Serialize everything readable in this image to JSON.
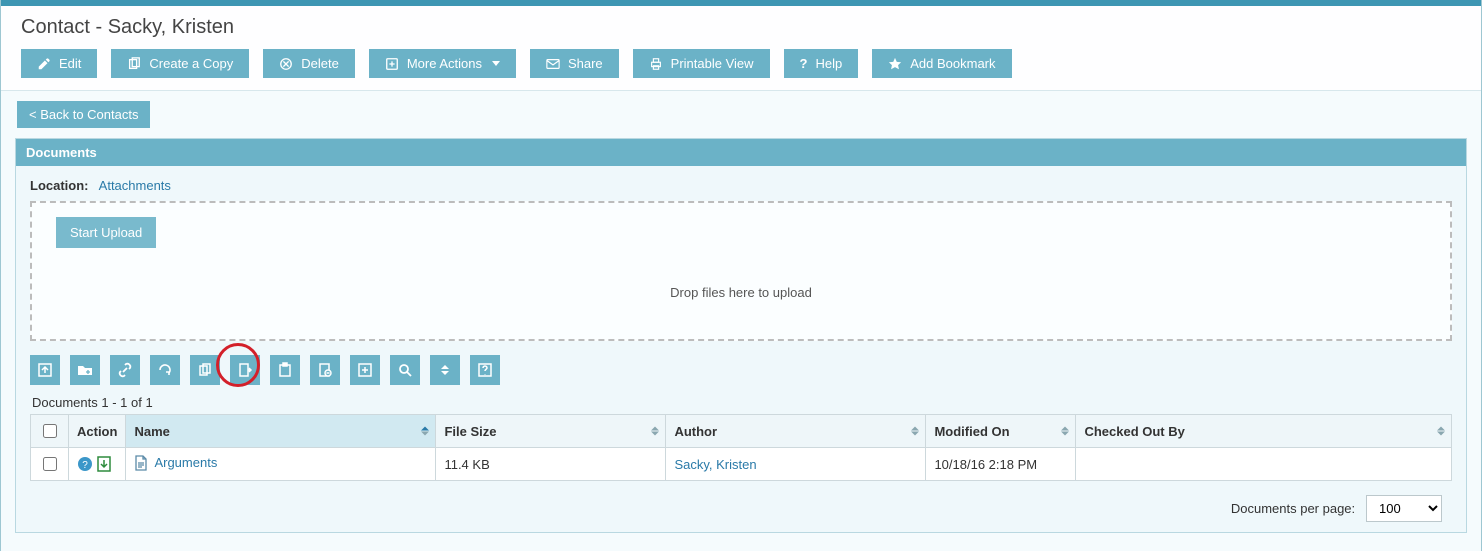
{
  "header": {
    "title": "Contact - Sacky, Kristen",
    "buttons": {
      "edit": "Edit",
      "copy": "Create a Copy",
      "delete": "Delete",
      "more": "More Actions",
      "share": "Share",
      "print": "Printable View",
      "help": "Help",
      "bookmark": "Add Bookmark"
    }
  },
  "back_button": "< Back to Contacts",
  "panel": {
    "title": "Documents",
    "location_label": "Location:",
    "location_value": "Attachments",
    "upload_button": "Start Upload",
    "drop_text": "Drop files here to upload"
  },
  "toolbar_icons": [
    "upload-icon",
    "new-folder-icon",
    "link-icon",
    "refresh-icon",
    "copy-icon",
    "export-icon",
    "paste-icon",
    "cancel-doc-icon",
    "move-icon",
    "search-icon",
    "sort-icon",
    "help-icon"
  ],
  "grid": {
    "count_text": "Documents 1 - 1 of 1",
    "columns": {
      "action": "Action",
      "name": "Name",
      "size": "File Size",
      "author": "Author",
      "modified": "Modified On",
      "checked_out": "Checked Out By"
    },
    "rows": [
      {
        "name": "Arguments",
        "size": "11.4 KB",
        "author": "Sacky, Kristen",
        "modified": "10/18/16 2:18 PM",
        "checked_out": ""
      }
    ]
  },
  "pager": {
    "label": "Documents per page:",
    "value": "100"
  }
}
